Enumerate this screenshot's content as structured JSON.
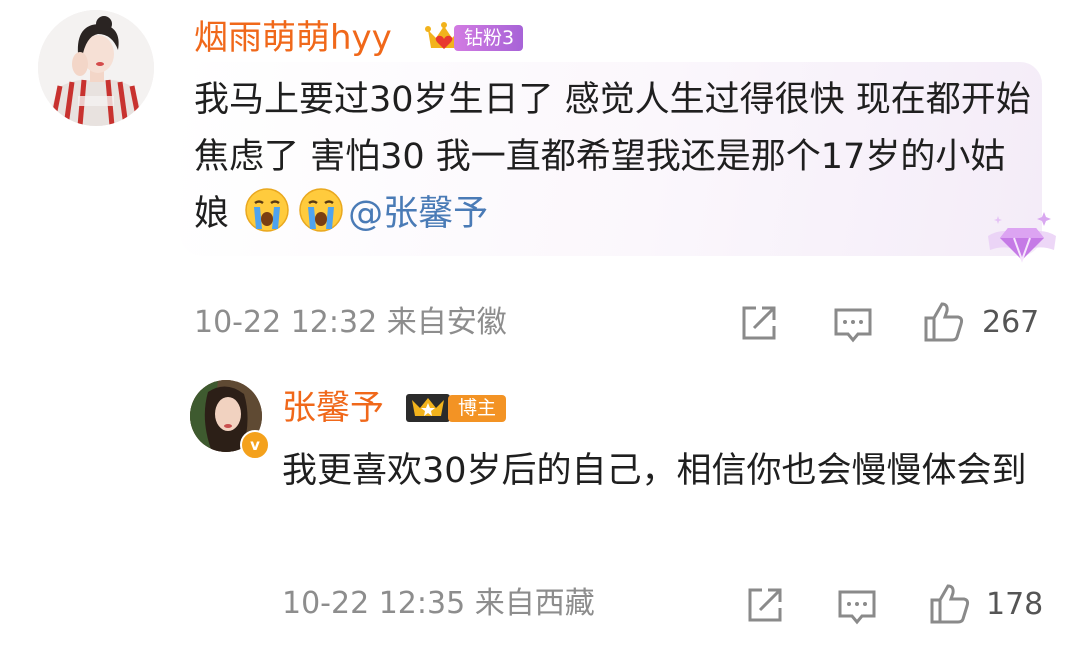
{
  "comment": {
    "username": "烟雨萌萌hyy",
    "fan_badge": "钻粉3",
    "text_before_mention": "我马上要过30岁生日了 感觉人生过得很快 现在都开始焦虑了 害怕30 我一直都希望我还是那个17岁的小姑娘",
    "emojis": [
      "crying-face-icon",
      "crying-face-icon"
    ],
    "mention": "@张馨予",
    "time": "10-22 12:32",
    "location": "来自安徽",
    "likes": "267"
  },
  "reply": {
    "username": "张馨予",
    "role_badge": "博主",
    "verified_mark": "v",
    "text": "我更喜欢30岁后的自己，相信你也会慢慢体会到",
    "time": "10-22 12:35",
    "location": "来自西藏",
    "likes": "178"
  },
  "colors": {
    "username": "#f0681a",
    "mention": "#4a7bb6",
    "meta": "#8d8d8d",
    "fan_badge": "#b06ad8",
    "host_badge": "#f39324"
  }
}
